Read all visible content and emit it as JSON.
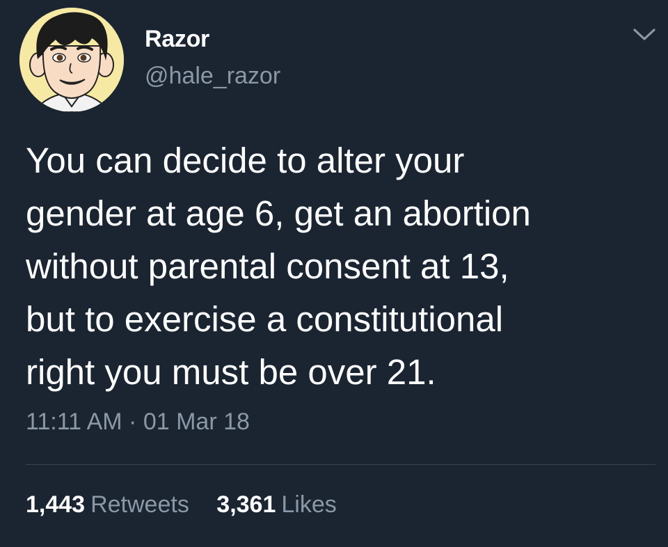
{
  "tweet": {
    "author": {
      "display_name": "Razor",
      "handle": "@hale_razor",
      "avatar_icon": "cartoon-avatar-icon"
    },
    "menu_icon": "chevron-down-icon",
    "text_lines": [
      "You can decide to alter your",
      "gender at age 6, get an abortion",
      "without parental consent at 13,",
      "but to exercise a constitutional",
      "right you must be over 21."
    ],
    "timestamp": "11:11 AM · 01 Mar 18",
    "stats": {
      "retweets": {
        "count": "1,443",
        "label": "Retweets"
      },
      "likes": {
        "count": "3,361",
        "label": "Likes"
      }
    }
  },
  "colors": {
    "background": "#1b2532",
    "text_primary": "#ffffff",
    "text_secondary": "#8b98a5",
    "divider": "#38444d",
    "avatar_background": "#f6e9a3"
  }
}
